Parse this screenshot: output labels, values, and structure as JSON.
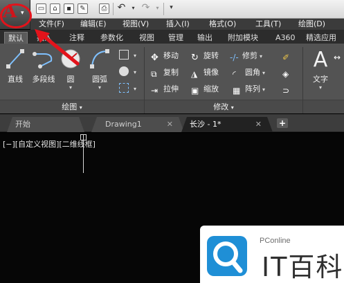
{
  "quick_access": {
    "icons": [
      "new-icon",
      "open-icon",
      "save-icon",
      "saveas-icon",
      "print-icon",
      "undo-icon",
      "redo-icon"
    ]
  },
  "menubar": {
    "items": [
      "文件(F)",
      "编辑(E)",
      "视图(V)",
      "插入(I)",
      "格式(O)",
      "工具(T)",
      "绘图(D)"
    ]
  },
  "ribbon_tabs": {
    "items": [
      "默认",
      "插入",
      "注释",
      "参数化",
      "视图",
      "管理",
      "输出",
      "附加模块",
      "A360",
      "精选应用"
    ]
  },
  "draw_panel": {
    "title": "绘图",
    "tools": {
      "line": "直线",
      "polyline": "多段线",
      "circle": "圆",
      "arc": "圆弧"
    }
  },
  "modify_panel": {
    "title": "修改",
    "tools": {
      "move": "移动",
      "rotate": "旋转",
      "trim": "修剪",
      "copy": "复制",
      "mirror": "镜像",
      "fillet": "圆角",
      "stretch": "拉伸",
      "scale": "缩放",
      "array": "阵列"
    }
  },
  "annotation_panel": {
    "text": "文字"
  },
  "doc_tabs": {
    "items": [
      "开始",
      "Drawing1",
      "长沙 - 1*"
    ],
    "new_tab": "+"
  },
  "viewport": {
    "label": "[−][自定义视图][二维线框]"
  },
  "watermark": {
    "brand": "PConline",
    "name": "IT百科"
  },
  "colors": {
    "annotation": "#e3131b",
    "ribbon": "#535353",
    "canvas": "#060606"
  }
}
